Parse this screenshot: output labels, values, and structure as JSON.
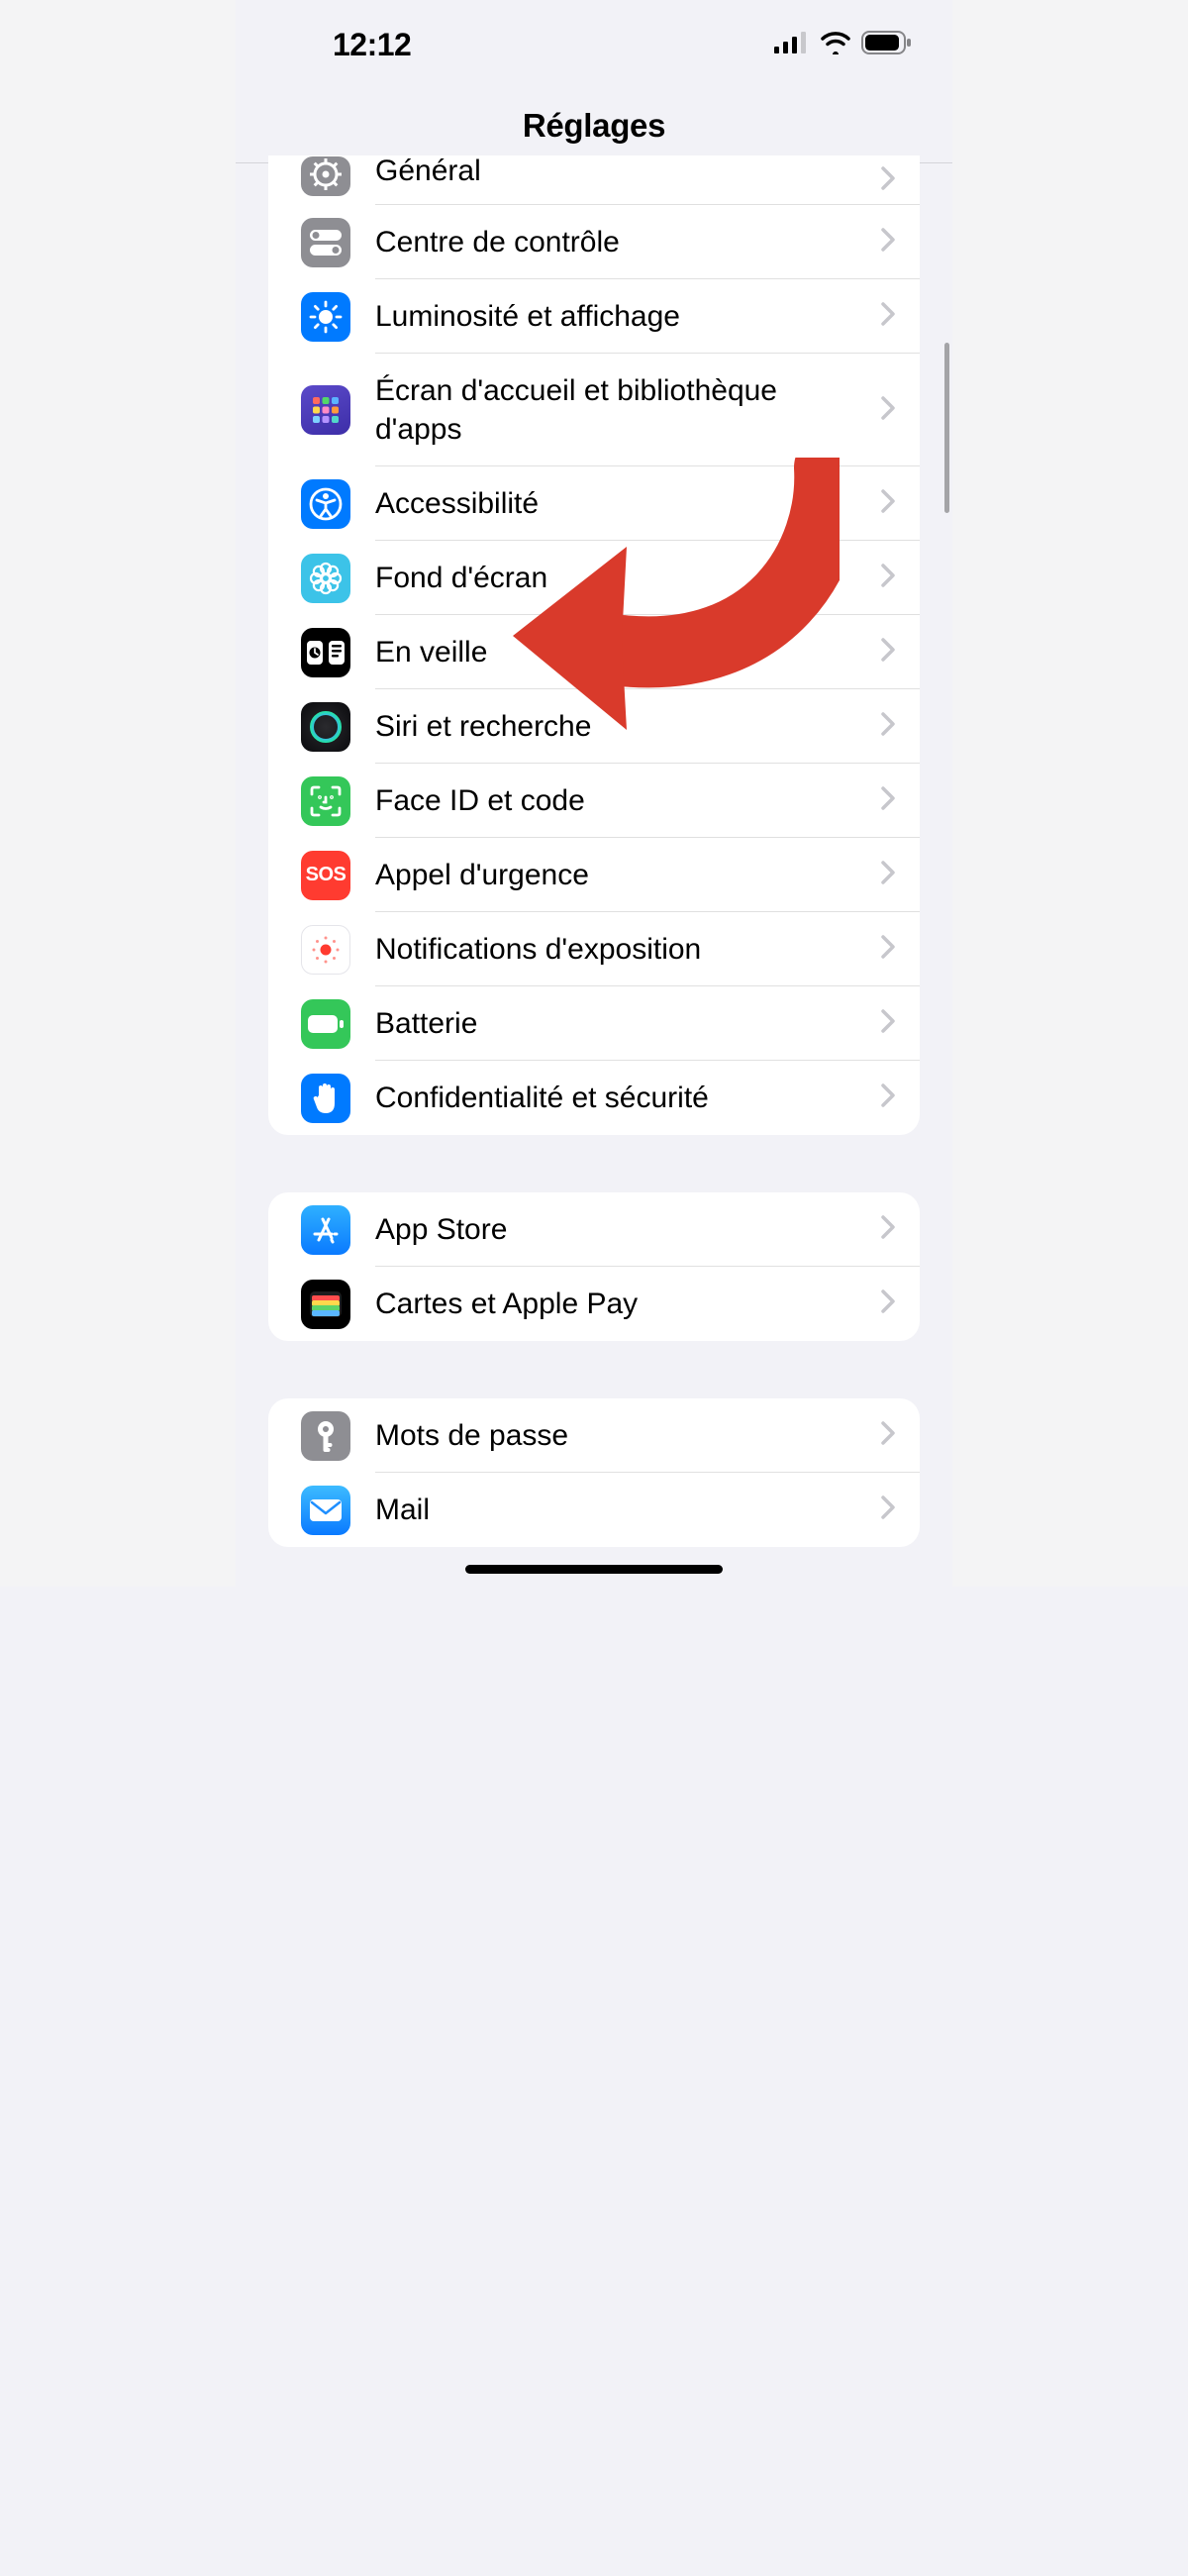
{
  "status": {
    "time": "12:12"
  },
  "header": {
    "title": "Réglages"
  },
  "groups": [
    {
      "id": "g1",
      "first": true,
      "rows": [
        {
          "id": "general",
          "label": "Général",
          "icon": "gear",
          "bg": "#8e8e93"
        },
        {
          "id": "control-center",
          "label": "Centre de contrôle",
          "icon": "toggles",
          "bg": "#8e8e93"
        },
        {
          "id": "display",
          "label": "Luminosité et affichage",
          "icon": "sun",
          "bg": "#007aff"
        },
        {
          "id": "home-screen",
          "label": "Écran d'accueil et bibliothèque d'apps",
          "icon": "grid",
          "bg": "#4f3db8"
        },
        {
          "id": "accessibility",
          "label": "Accessibilité",
          "icon": "accessibility",
          "bg": "#007aff"
        },
        {
          "id": "wallpaper",
          "label": "Fond d'écran",
          "icon": "flower",
          "bg": "#3cc3e8"
        },
        {
          "id": "standby",
          "label": "En veille",
          "icon": "standby",
          "bg": "#000000"
        },
        {
          "id": "siri",
          "label": "Siri et recherche",
          "icon": "siri",
          "bg": "#1c1c1e"
        },
        {
          "id": "faceid",
          "label": "Face ID et code",
          "icon": "faceid",
          "bg": "#34c759"
        },
        {
          "id": "sos",
          "label": "Appel d'urgence",
          "icon": "sos",
          "bg": "#ff3b30"
        },
        {
          "id": "exposure",
          "label": "Notifications d'exposition",
          "icon": "exposure",
          "bg": "#ffffff"
        },
        {
          "id": "battery",
          "label": "Batterie",
          "icon": "battery",
          "bg": "#34c759"
        },
        {
          "id": "privacy",
          "label": "Confidentialité et sécurité",
          "icon": "hand",
          "bg": "#007aff"
        }
      ]
    },
    {
      "id": "g2",
      "rows": [
        {
          "id": "appstore",
          "label": "App Store",
          "icon": "appstore",
          "bg": "#1f8fff"
        },
        {
          "id": "wallet",
          "label": "Cartes et Apple Pay",
          "icon": "wallet",
          "bg": "#000000"
        }
      ]
    },
    {
      "id": "g3",
      "rows": [
        {
          "id": "passwords",
          "label": "Mots de passe",
          "icon": "key",
          "bg": "#8e8e93"
        },
        {
          "id": "mail",
          "label": "Mail",
          "icon": "mail",
          "bg": "#1f8fff"
        }
      ]
    }
  ],
  "sos_text": "SOS"
}
